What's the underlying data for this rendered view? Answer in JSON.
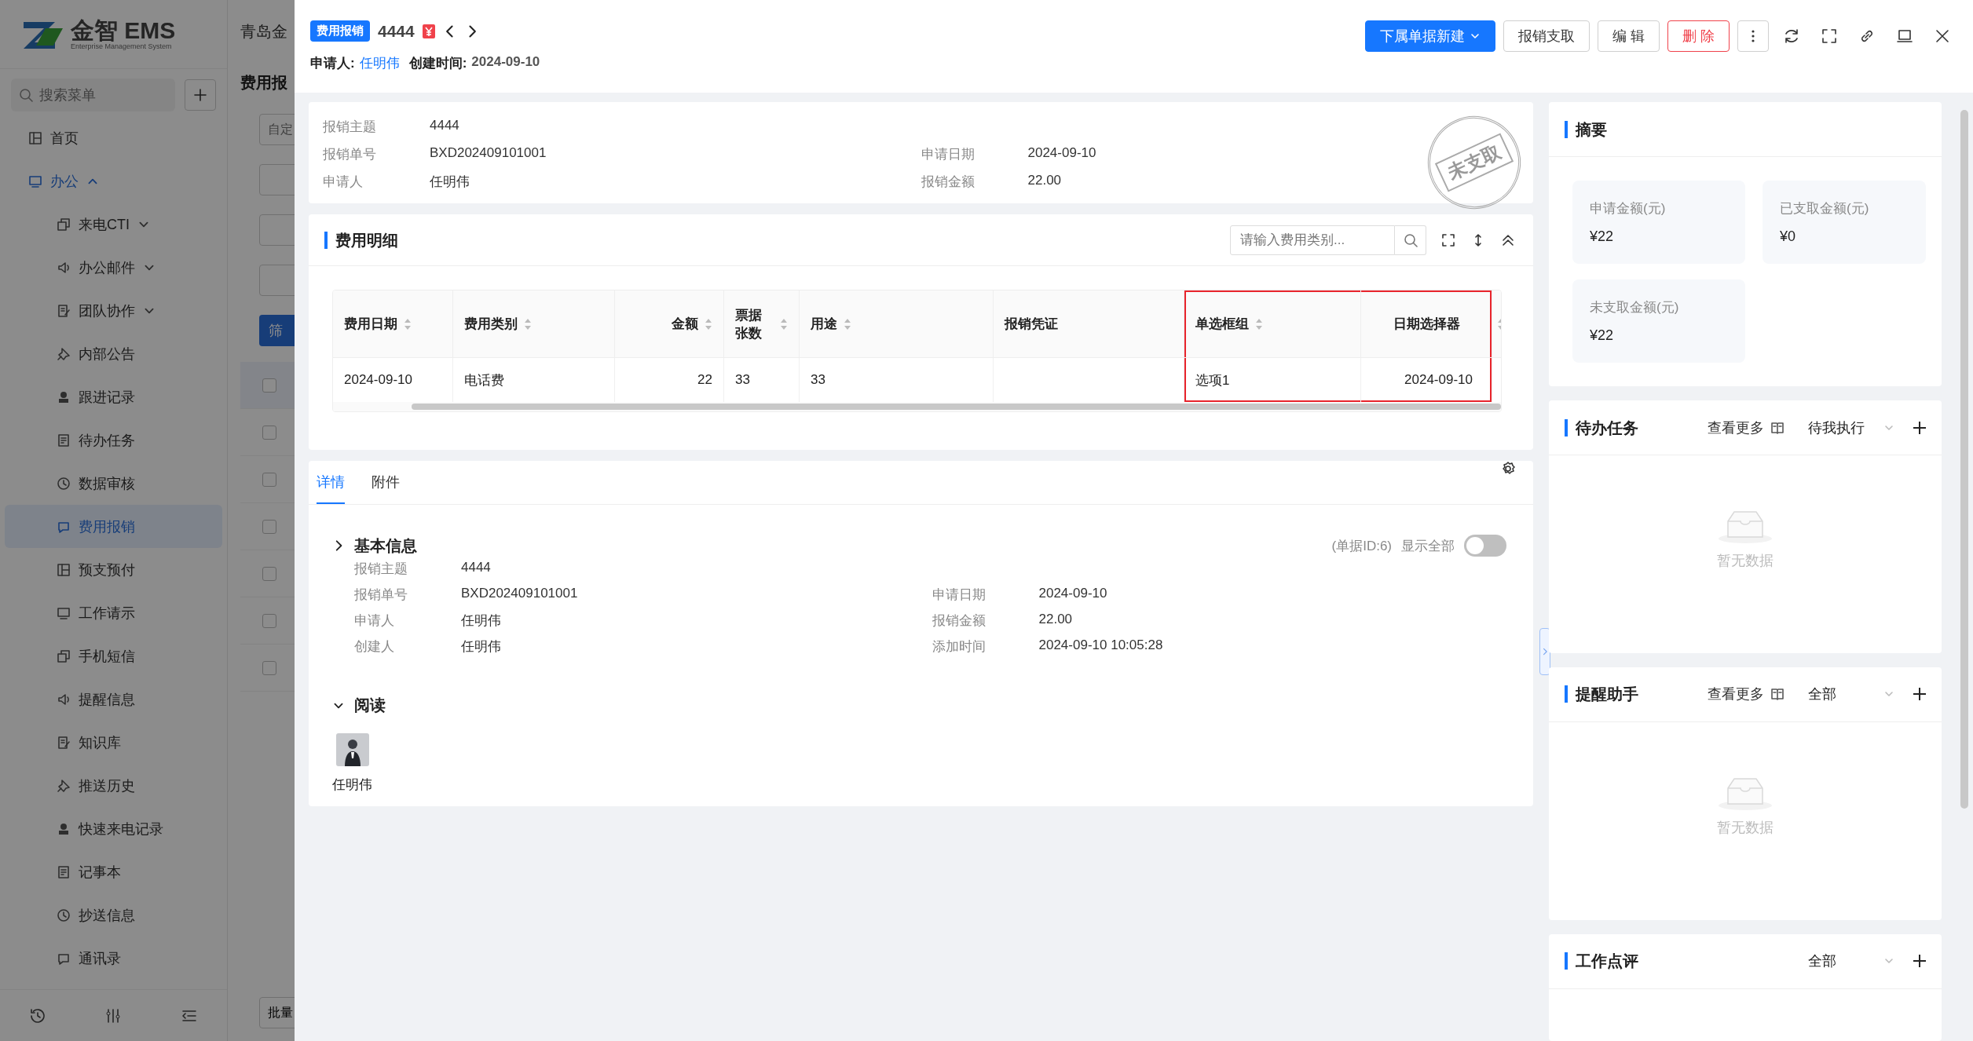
{
  "background_page": {
    "logo": {
      "name": "金智 EMS",
      "subtitle": "Enterprise Management System"
    },
    "company_title": "青岛金",
    "search": {
      "placeholder": "搜索菜单"
    },
    "menu": [
      {
        "label": "首页",
        "kind": "link",
        "selected": false
      },
      {
        "label": "办公",
        "kind": "group",
        "expanded": true,
        "selected": false,
        "children": [
          {
            "label": "来电CTI",
            "kind": "group",
            "expanded": false,
            "selected": false
          },
          {
            "label": "办公邮件",
            "kind": "group",
            "expanded": false,
            "selected": false
          },
          {
            "label": "团队协作",
            "kind": "group",
            "expanded": false,
            "selected": false
          },
          {
            "label": "内部公告",
            "kind": "link",
            "selected": false
          },
          {
            "label": "跟进记录",
            "kind": "link",
            "selected": false
          },
          {
            "label": "待办任务",
            "kind": "link",
            "selected": false
          },
          {
            "label": "数据审核",
            "kind": "link",
            "selected": false
          },
          {
            "label": "费用报销",
            "kind": "link",
            "selected": true
          },
          {
            "label": "预支预付",
            "kind": "link",
            "selected": false
          },
          {
            "label": "工作请示",
            "kind": "link",
            "selected": false
          },
          {
            "label": "手机短信",
            "kind": "link",
            "selected": false
          },
          {
            "label": "提醒信息",
            "kind": "link",
            "selected": false
          },
          {
            "label": "知识库",
            "kind": "link",
            "selected": false
          },
          {
            "label": "推送历史",
            "kind": "link",
            "selected": false
          },
          {
            "label": "快速来电记录",
            "kind": "link",
            "selected": false
          },
          {
            "label": "记事本",
            "kind": "link",
            "selected": false
          },
          {
            "label": "抄送信息",
            "kind": "link",
            "selected": false
          },
          {
            "label": "通讯录",
            "kind": "link",
            "selected": false
          }
        ]
      }
    ],
    "page_title": "费用报",
    "filter_placeholder": "自定",
    "filter_button": "筛",
    "table_rows": [
      {
        "checked": false
      },
      {
        "checked": false
      },
      {
        "checked": false
      },
      {
        "checked": false
      },
      {
        "checked": false
      },
      {
        "checked": false
      },
      {
        "checked": false
      }
    ],
    "batch_button": "批量"
  },
  "drawer": {
    "tag": "费用报销",
    "title": "4444",
    "meta": [
      {
        "label": "申请人:",
        "value": "任明伟",
        "kind": "link"
      },
      {
        "label": "创建时间:",
        "value": "2024-09-10",
        "kind": "text"
      }
    ],
    "buttons": [
      {
        "label": "下属单据新建",
        "kind": "primary"
      },
      {
        "label": "报销支取",
        "kind": "default"
      },
      {
        "label": "编 辑",
        "kind": "default"
      },
      {
        "label": "删 除",
        "kind": "danger"
      }
    ],
    "summary": {
      "fields": [
        {
          "left": {
            "label": "报销主题",
            "value": "4444"
          }
        },
        {
          "left": {
            "label": "报销单号",
            "value": "BXD202409101001"
          },
          "right": {
            "label": "申请日期",
            "value": "2024-09-10"
          }
        },
        {
          "left": {
            "label": "申请人",
            "value": "任明伟"
          },
          "right": {
            "label": "报销金额",
            "value": "22.00"
          }
        }
      ],
      "stamp": "未支取"
    },
    "detail": {
      "title": "费用明细",
      "search": {
        "placeholder": "请输入费用类别..."
      },
      "columns": [
        {
          "label": "费用日期",
          "sortable": true,
          "highlighted": false
        },
        {
          "label": "费用类别",
          "sortable": true,
          "highlighted": false
        },
        {
          "label": "金额",
          "sortable": true,
          "highlighted": false
        },
        {
          "label": "票据张数",
          "sortable": true,
          "highlighted": false
        },
        {
          "label": "用途",
          "sortable": true,
          "highlighted": false
        },
        {
          "label": "报销凭证",
          "sortable": false,
          "highlighted": false
        },
        {
          "label": "单选框组",
          "sortable": true,
          "highlighted": true
        },
        {
          "label": "日期选择器",
          "sortable": false,
          "highlighted": true
        }
      ],
      "rows": [
        [
          "2024-09-10",
          "电话费",
          "22",
          "33",
          "33",
          "",
          "选项1",
          "2024-09-10"
        ]
      ]
    },
    "tabs": [
      {
        "label": "详情",
        "selected": true
      },
      {
        "label": "附件",
        "selected": false
      }
    ],
    "basic_info": {
      "title": "基本信息",
      "doc_id": "(单据ID:6)",
      "show_all": {
        "label": "显示全部",
        "on": false
      },
      "fields": [
        {
          "left": {
            "label": "报销主题",
            "value": "4444"
          }
        },
        {
          "left": {
            "label": "报销单号",
            "value": "BXD202409101001"
          },
          "right": {
            "label": "申请日期",
            "value": "2024-09-10"
          }
        },
        {
          "left": {
            "label": "申请人",
            "value": "任明伟"
          },
          "right": {
            "label": "报销金额",
            "value": "22.00"
          }
        },
        {
          "left": {
            "label": "创建人",
            "value": "任明伟"
          },
          "right": {
            "label": "添加时间",
            "value": "2024-09-10 10:05:28"
          }
        }
      ]
    },
    "readers": {
      "title": "阅读",
      "people": [
        {
          "name": "任明伟"
        }
      ]
    }
  },
  "side": {
    "summary": {
      "title": "摘要",
      "stats": [
        {
          "label": "申请金额(元)",
          "value": "¥22"
        },
        {
          "label": "已支取金额(元)",
          "value": "¥0"
        },
        {
          "label": "未支取金额(元)",
          "value": "¥22"
        }
      ]
    },
    "panels": [
      {
        "title": "待办任务",
        "more": "查看更多",
        "filter": "待我执行",
        "empty": "暂无数据"
      },
      {
        "title": "提醒助手",
        "more": "查看更多",
        "filter": "全部",
        "empty": "暂无数据"
      },
      {
        "title": "工作点评",
        "filter": "全部"
      }
    ]
  }
}
